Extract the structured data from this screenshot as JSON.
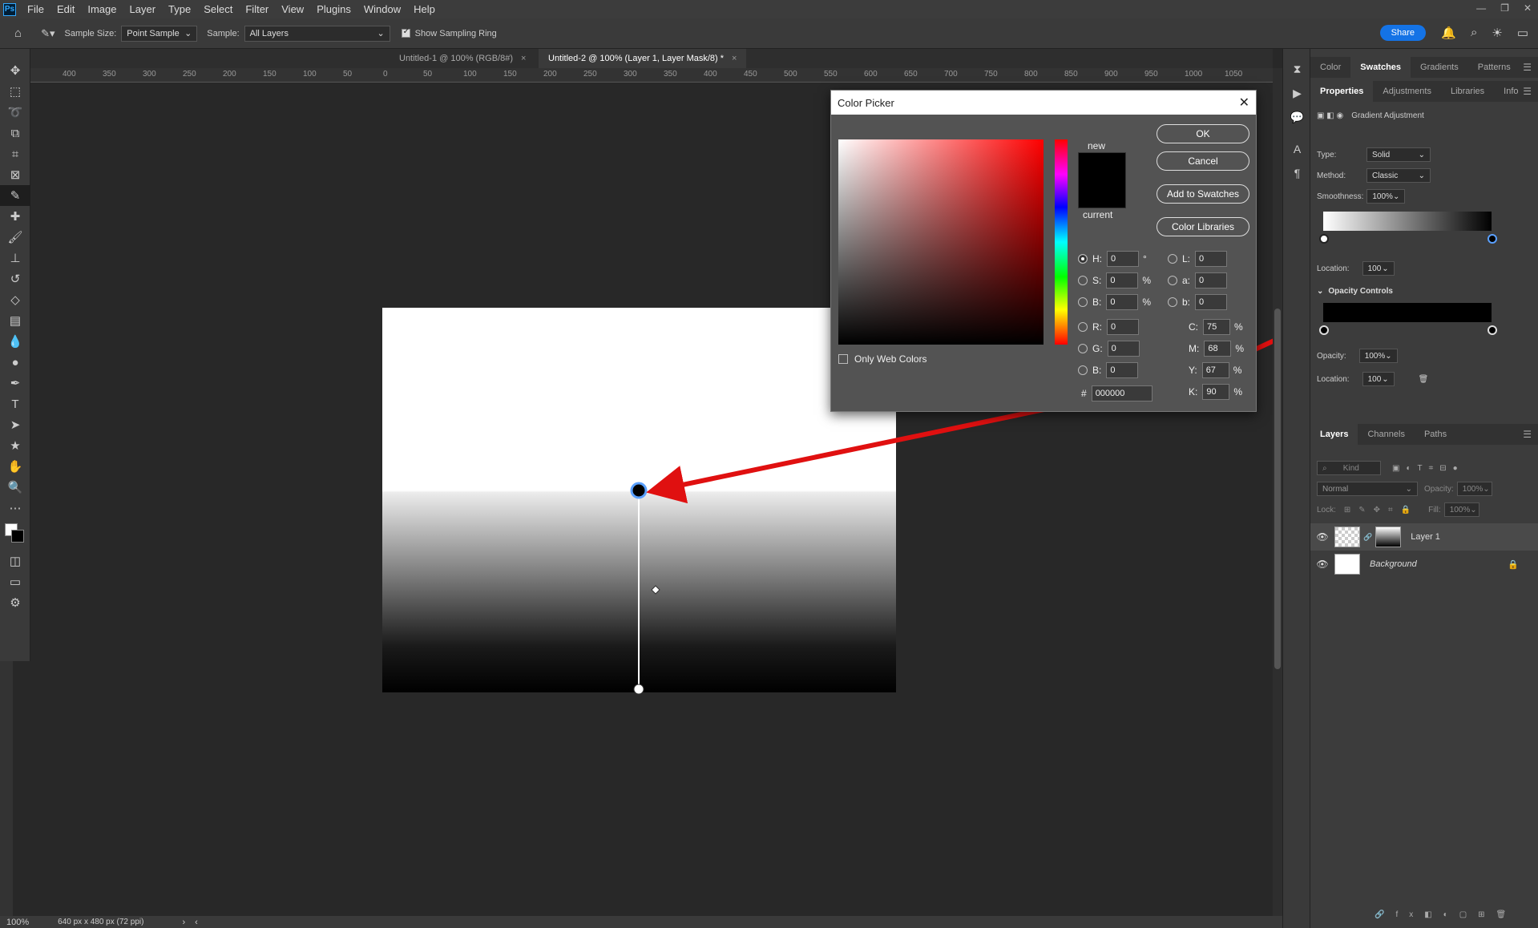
{
  "app": {
    "logo": "Ps",
    "menus": [
      "File",
      "Edit",
      "Image",
      "Layer",
      "Type",
      "Select",
      "Filter",
      "View",
      "Plugins",
      "Window",
      "Help"
    ]
  },
  "options_bar": {
    "sample_size_label": "Sample Size:",
    "sample_size_value": "Point Sample",
    "sample_label": "Sample:",
    "sample_value": "All Layers",
    "show_ring_label": "Show Sampling Ring",
    "share_label": "Share"
  },
  "tabs": [
    {
      "label": "Untitled-1 @ 100% (RGB/8#)",
      "close": "×"
    },
    {
      "label": "Untitled-2 @ 100% (Layer 1, Layer Mask/8) *",
      "close": "×"
    }
  ],
  "ruler_ticks": [
    "400",
    "350",
    "300",
    "250",
    "200",
    "150",
    "100",
    "50",
    "0",
    "50",
    "100",
    "150",
    "200",
    "250",
    "300",
    "350",
    "400",
    "450",
    "500",
    "550",
    "600",
    "650",
    "700",
    "750",
    "800",
    "850",
    "900",
    "950",
    "1000",
    "1050"
  ],
  "status": {
    "zoom": "100%",
    "doc_info": "640 px x 480 px (72 ppi)"
  },
  "dialog": {
    "title": "Color Picker",
    "new_label": "new",
    "current_label": "current",
    "ok": "OK",
    "cancel": "Cancel",
    "add_swatches": "Add to Swatches",
    "color_libraries": "Color Libraries",
    "only_web": "Only Web Colors",
    "hsb": [
      {
        "label": "H:",
        "value": "0",
        "unit": "°"
      },
      {
        "label": "S:",
        "value": "0",
        "unit": "%"
      },
      {
        "label": "B:",
        "value": "0",
        "unit": "%"
      }
    ],
    "rgb": [
      {
        "label": "R:",
        "value": "0"
      },
      {
        "label": "G:",
        "value": "0"
      },
      {
        "label": "B:",
        "value": "0"
      }
    ],
    "lab": [
      {
        "label": "L:",
        "value": "0"
      },
      {
        "label": "a:",
        "value": "0"
      },
      {
        "label": "b:",
        "value": "0"
      }
    ],
    "cmyk": [
      {
        "label": "C:",
        "value": "75",
        "unit": "%"
      },
      {
        "label": "M:",
        "value": "68",
        "unit": "%"
      },
      {
        "label": "Y:",
        "value": "67",
        "unit": "%"
      },
      {
        "label": "K:",
        "value": "90",
        "unit": "%"
      }
    ],
    "hex_label": "#",
    "hex_value": "000000"
  },
  "panel_top": {
    "tabs": [
      "Color",
      "Swatches",
      "Gradients",
      "Patterns"
    ],
    "active": "Swatches"
  },
  "properties": {
    "tabs": [
      "Properties",
      "Adjustments",
      "Libraries",
      "Info"
    ],
    "title": "Gradient Adjustment",
    "type_label": "Type:",
    "type_value": "Solid",
    "method_label": "Method:",
    "method_value": "Classic",
    "smoothness_label": "Smoothness:",
    "smoothness_value": "100%",
    "location_label": "Location:",
    "location_value": "100",
    "opacity_controls_label": "Opacity Controls",
    "opacity_label": "Opacity:",
    "opacity_value": "100%",
    "location2_value": "100"
  },
  "layers": {
    "tabs": [
      "Layers",
      "Channels",
      "Paths"
    ],
    "kind_placeholder": "Kind",
    "blend_mode": "Normal",
    "opacity_label": "Opacity:",
    "opacity_value": "100%",
    "lock_label": "Lock:",
    "fill_label": "Fill:",
    "fill_value": "100%",
    "items": [
      {
        "name": "Layer 1"
      },
      {
        "name": "Background"
      }
    ]
  },
  "colors": {
    "accent": "#1473e6",
    "annotation": "#e01010"
  }
}
